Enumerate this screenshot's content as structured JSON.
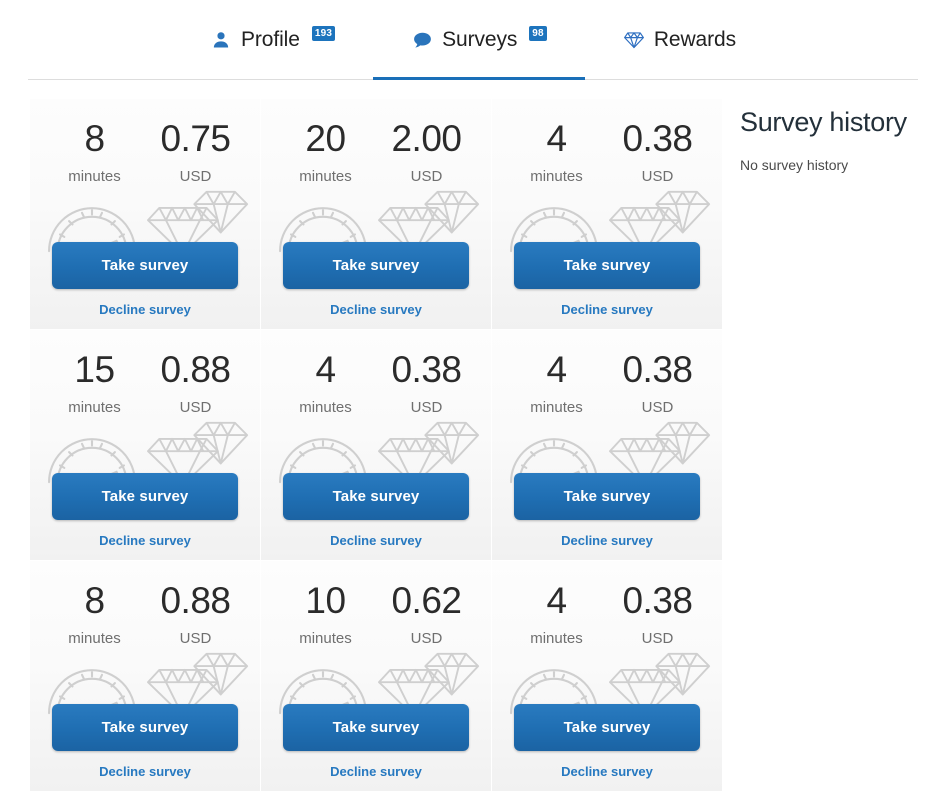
{
  "tabs": [
    {
      "id": "profile",
      "label": "Profile",
      "icon": "user-icon",
      "badge": "193",
      "active": false
    },
    {
      "id": "surveys",
      "label": "Surveys",
      "icon": "chat-bubble-icon",
      "badge": "98",
      "active": true
    },
    {
      "id": "rewards",
      "label": "Rewards",
      "icon": "diamond-icon",
      "badge": "",
      "active": false
    }
  ],
  "survey_card_labels": {
    "minutes_unit": "minutes",
    "currency_unit": "USD",
    "take_label": "Take survey",
    "decline_label": "Decline survey",
    "clock_icon": "clock-gauge-icon",
    "reward_icon": "diamonds-icon"
  },
  "surveys": [
    {
      "minutes": "8",
      "amount": "0.75"
    },
    {
      "minutes": "20",
      "amount": "2.00"
    },
    {
      "minutes": "4",
      "amount": "0.38"
    },
    {
      "minutes": "15",
      "amount": "0.88"
    },
    {
      "minutes": "4",
      "amount": "0.38"
    },
    {
      "minutes": "4",
      "amount": "0.38"
    },
    {
      "minutes": "8",
      "amount": "0.88"
    },
    {
      "minutes": "10",
      "amount": "0.62"
    },
    {
      "minutes": "4",
      "amount": "0.38"
    }
  ],
  "history": {
    "title": "Survey history",
    "empty_text": "No survey history"
  },
  "colors": {
    "accent_blue": "#1d74bd",
    "button_blue": "#1f6eb2",
    "link_blue": "#2779c0",
    "icon_grey": "#cfcfcf",
    "text_dark": "#2b2b2b"
  }
}
